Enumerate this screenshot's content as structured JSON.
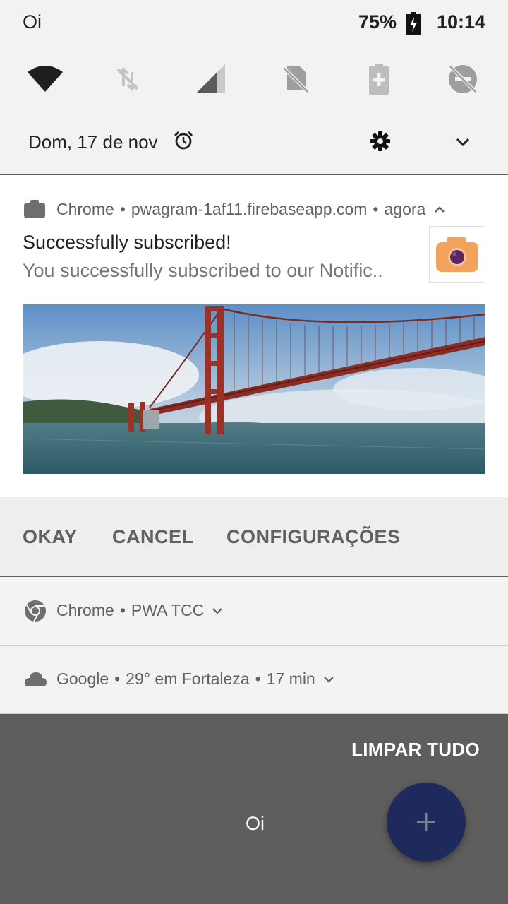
{
  "status_bar": {
    "carrier": "Oi",
    "battery_percent": "75%",
    "time": "10:14"
  },
  "quick_settings": {
    "tiles": [
      {
        "icon": "wifi-icon",
        "state": "on"
      },
      {
        "icon": "data-off-icon",
        "state": "off"
      },
      {
        "icon": "cellular-signal-icon",
        "state": "on"
      },
      {
        "icon": "no-sim-icon",
        "state": "off"
      },
      {
        "icon": "battery-saver-icon",
        "state": "off"
      },
      {
        "icon": "do-not-disturb-off-icon",
        "state": "off"
      }
    ],
    "date": "Dom, 17 de nov"
  },
  "main_notification": {
    "app_name": "Chrome",
    "source": "pwagram-1af11.firebaseapp.com",
    "time": "agora",
    "title": "Successfully subscribed!",
    "body": "You successfully subscribed to our Notific..",
    "actions": [
      "OKAY",
      "CANCEL",
      "CONFIGURAÇÕES"
    ]
  },
  "other_notifications": [
    {
      "app": "Chrome",
      "text": "PWA TCC",
      "icon": "chrome-icon"
    },
    {
      "app": "Google",
      "text": "29° em Fortaleza",
      "time": "17 min",
      "icon": "cloud-icon"
    }
  ],
  "clear_all_label": "LIMPAR TUDO",
  "bottom_label": "Oi",
  "colors": {
    "fab": "#1f2a5c",
    "scrim": "#5e5e5e",
    "camera_icon": "#f4a35d"
  }
}
